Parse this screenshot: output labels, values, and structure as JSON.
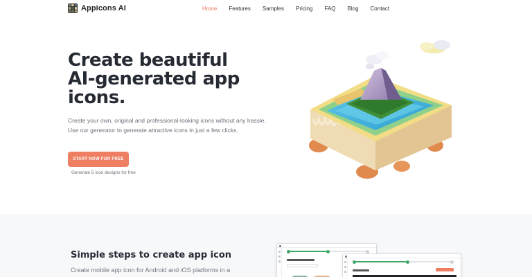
{
  "brand": {
    "name": "Appicons AI",
    "logo_colors": [
      "#7d8a6b",
      "#c9b48e",
      "#5e6f7e",
      "#a9a28b",
      "#4e5a46",
      "#d6c7a5",
      "#8f7d5c",
      "#6b7b58",
      "#b9a57d"
    ]
  },
  "nav": {
    "items": [
      {
        "label": "Home",
        "active": true
      },
      {
        "label": "Features",
        "active": false
      },
      {
        "label": "Samples",
        "active": false
      },
      {
        "label": "Pricing",
        "active": false
      },
      {
        "label": "FAQ",
        "active": false
      },
      {
        "label": "Blog",
        "active": false
      },
      {
        "label": "Contact",
        "active": false
      }
    ]
  },
  "hero": {
    "title_lines": [
      "Create beautiful",
      "AI-generated app",
      "icons."
    ],
    "description": "Create your own, original and professional-looking icons without any hassle. Use our generator to generate attractive icons in just a few clicks.",
    "cta_label": "START NOW FOR FREE",
    "cta_note": "Generate 5 icon designs for free",
    "illustration": "isometric-island-icon"
  },
  "steps_section": {
    "title": "Simple steps to create app icon",
    "description": "Create mobile app icon for Android and iOS platforms in a"
  },
  "colors": {
    "accent": "#ef7f63",
    "active_nav": "#ee7c62",
    "heading": "#262a33",
    "body_text": "#6b7079",
    "section_bg": "#f7f8fa",
    "step_green": "#42a86a"
  }
}
